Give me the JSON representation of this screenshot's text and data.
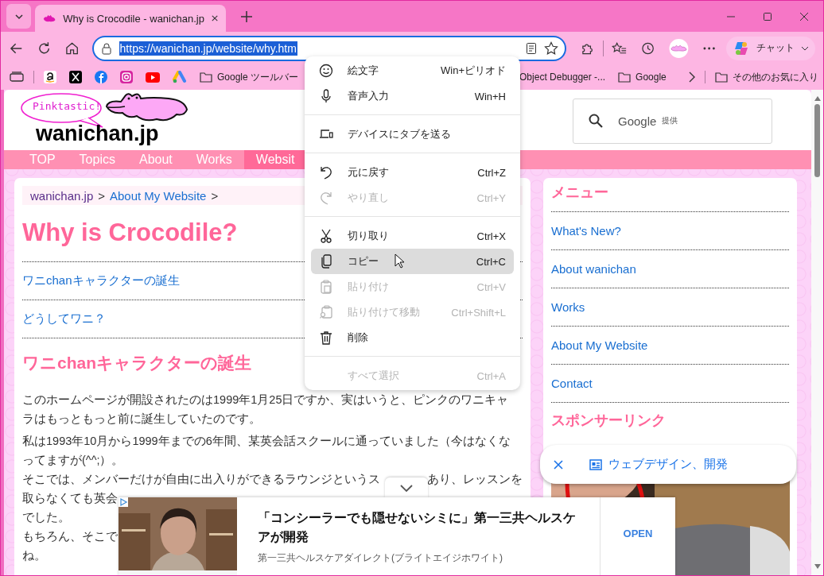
{
  "browser": {
    "tabs": [
      {
        "title": "Why is Crocodile - wanichan.jp",
        "selected": true
      }
    ],
    "address": "https://wanichan.jp/website/why.htm",
    "chat_label": "チャット",
    "bookmarks": [
      {
        "label": "Google ツールバー"
      },
      {
        "label": "Object Debugger -..."
      },
      {
        "label": "Google"
      }
    ],
    "other_bookmarks": "その他のお気に入り"
  },
  "site": {
    "logo_bubble": "Pinktastic!",
    "logo_text": "wanichan.jp",
    "search": {
      "label": "Google",
      "suffix": "提供"
    },
    "nav": [
      {
        "label": "TOP",
        "selected": false
      },
      {
        "label": "Topics",
        "selected": false
      },
      {
        "label": "About",
        "selected": false
      },
      {
        "label": "Works",
        "selected": false
      },
      {
        "label": "Websit",
        "selected": true
      }
    ]
  },
  "breadcrumb": {
    "home": "wanichan.jp",
    "separator": ">",
    "current": "About My Website",
    "trail": ">"
  },
  "article": {
    "title": "Why is Crocodile?",
    "toc": [
      "ワニchanキャラクターの誕生",
      "どうしてワニ？"
    ],
    "heading": "ワニchanキャラクターの誕生",
    "paragraphs": [
      [
        [
          "このホームページが開設されたのは1999年1月25日ですか、実はいうと、ピンクのワニキャ"
        ],
        [
          "ラはもっともっと前に誕生していたのです。"
        ]
      ],
      [
        [
          "私は1993年10月から1999年までの6年間、某英会話スクールに通っていました（今はなくな"
        ],
        [
          "ってますが(^^;）。"
        ],
        [
          "そこでは、メンバーだけが自由に出入りができるラウンジというス",
          "あり、レッスンを"
        ],
        [
          "取らなくても英会"
        ],
        [
          "でした。"
        ],
        [
          "もちろん、そこで"
        ],
        [
          "ね。"
        ]
      ]
    ]
  },
  "sidebar": {
    "menu_title": "メニュー",
    "links": [
      "What's New?",
      "About wanichan",
      "Works",
      "About My Website",
      "Contact"
    ],
    "sponsor_title": "スポンサーリンク"
  },
  "context_menu": [
    {
      "kind": "item",
      "label": "絵文字",
      "shortcut": "Win+ピリオド",
      "disabled": false,
      "highlighted": false
    },
    {
      "kind": "item",
      "label": "音声入力",
      "shortcut": "Win+H",
      "disabled": false,
      "highlighted": false
    },
    {
      "kind": "divider"
    },
    {
      "kind": "item",
      "label": "デバイスにタブを送る",
      "disabled": false,
      "highlighted": false
    },
    {
      "kind": "divider"
    },
    {
      "kind": "item",
      "label": "元に戻す",
      "shortcut": "Ctrl+Z",
      "disabled": false,
      "highlighted": false
    },
    {
      "kind": "item",
      "label": "やり直し",
      "shortcut": "Ctrl+Y",
      "disabled": true,
      "highlighted": false
    },
    {
      "kind": "divider"
    },
    {
      "kind": "item",
      "label": "切り取り",
      "shortcut": "Ctrl+X",
      "disabled": false,
      "highlighted": false
    },
    {
      "kind": "item",
      "label": "コピー",
      "shortcut": "Ctrl+C",
      "disabled": false,
      "highlighted": true
    },
    {
      "kind": "item",
      "label": "貼り付け",
      "shortcut": "Ctrl+V",
      "disabled": true,
      "highlighted": false
    },
    {
      "kind": "item",
      "label": "貼り付けて移動",
      "shortcut": "Ctrl+Shift+L",
      "disabled": true,
      "highlighted": false
    },
    {
      "kind": "item",
      "label": "削除",
      "disabled": false,
      "highlighted": false
    },
    {
      "kind": "divider"
    },
    {
      "kind": "item",
      "label": "すべて選択",
      "shortcut": "Ctrl+A",
      "disabled": true,
      "highlighted": false
    }
  ],
  "topic_pill": {
    "label": "ウェブデザイン、開発"
  },
  "ad": {
    "headline": "「コンシーラーでも隠せないシミに」第一三共ヘルスケアが開発",
    "advertiser": "第一三共ヘルスケアダイレクト(ブライトエイジホワイト)",
    "action": "OPEN"
  }
}
